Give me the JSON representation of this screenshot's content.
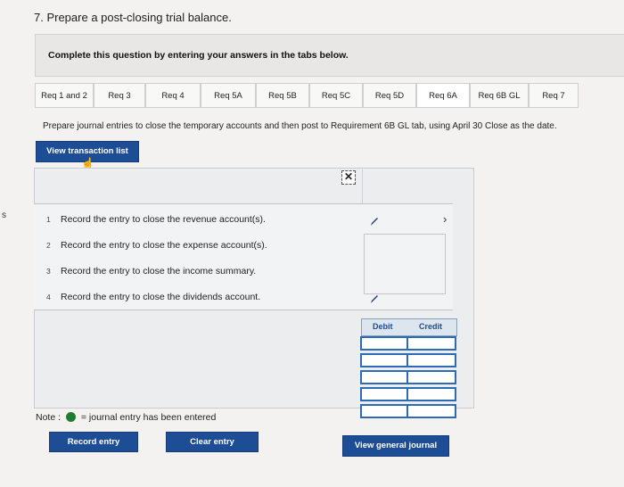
{
  "edge_mark": "s",
  "question": "7. Prepare a post-closing trial balance.",
  "instruction": "Complete this question by entering your answers in the tabs below.",
  "tabs": [
    {
      "label": "Req 1 and 2"
    },
    {
      "label": "Req 3"
    },
    {
      "label": "Req 4"
    },
    {
      "label": "Req 5A"
    },
    {
      "label": "Req 5B"
    },
    {
      "label": "Req 5C"
    },
    {
      "label": "Req 5D"
    },
    {
      "label": "Req 6A"
    },
    {
      "label": "Req 6B GL"
    },
    {
      "label": "Req 7"
    }
  ],
  "active_tab": "Req 6A",
  "prompt": "Prepare journal entries to close the temporary accounts and then post to Requirement 6B GL tab, using April 30 Close as the date.",
  "view_transaction_label": "View transaction list",
  "close_glyph": "✕",
  "next_glyph": "›",
  "tasks": [
    {
      "num": "1",
      "text": "Record the entry to close the revenue account(s)."
    },
    {
      "num": "2",
      "text": "Record the entry to close the expense account(s)."
    },
    {
      "num": "3",
      "text": "Record the entry to close the income summary."
    },
    {
      "num": "4",
      "text": "Record the entry to close the dividends account."
    }
  ],
  "grid": {
    "debit": "Debit",
    "credit": "Credit",
    "rows": 5
  },
  "note": {
    "label": "Note :",
    "text": "= journal entry has been entered",
    "dot_color": "#1e7d32"
  },
  "buttons": {
    "record": "Record entry",
    "clear": "Clear entry",
    "view_journal": "View general journal"
  },
  "colors": {
    "accent": "#1d4d94",
    "grid_border": "#2e6bb5"
  }
}
